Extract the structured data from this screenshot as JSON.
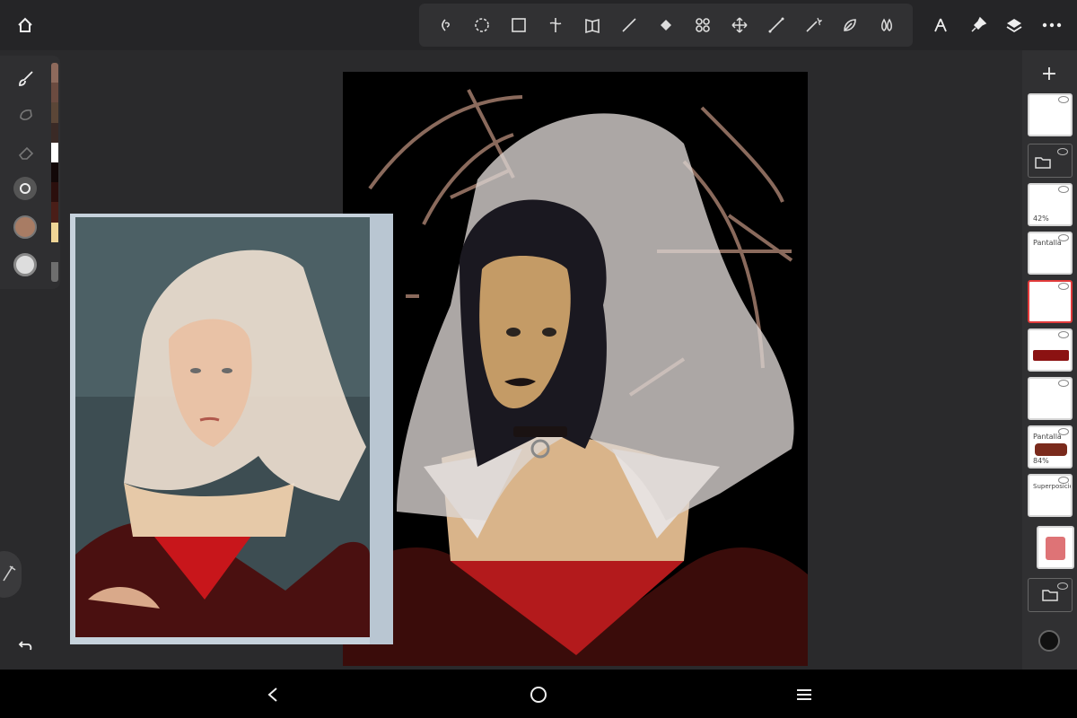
{
  "app": {
    "name": "Drawing app"
  },
  "top_toolbar": {
    "left": [
      "home-icon"
    ],
    "tools": [
      "lasso-freeform-icon",
      "lasso-dotted-icon",
      "rectangle-select-icon",
      "transform-icon",
      "mirror-icon",
      "line-icon",
      "fill-icon",
      "symmetry-icon",
      "move-icon",
      "ruler-icon",
      "magic-wand-icon",
      "smudge-icon",
      "blur-icon"
    ],
    "right": [
      "compass-icon",
      "pin-icon",
      "layers-icon",
      "more-icon"
    ]
  },
  "left_toolbar": {
    "tools": [
      "brush-icon",
      "smudge-icon",
      "eraser-icon",
      "brush-size-icon",
      "color-swatch",
      "opacity-icon"
    ],
    "brush_color": "#a87c64",
    "swatches": [
      "#8e6a5c",
      "#6b4b40",
      "#5b4637",
      "#3a2a26",
      "#ffffff",
      "#120808",
      "#2b0f0d",
      "#4a1e18",
      "#f0d596",
      "#3a3a3a",
      "#6e6e6e"
    ]
  },
  "layers_panel": {
    "layers": [
      {
        "name": "",
        "opacity": ""
      },
      {
        "name": "folder",
        "opacity": ""
      },
      {
        "name": "",
        "opacity": "42%"
      },
      {
        "name": "Pantalla",
        "opacity": ""
      },
      {
        "name": "",
        "opacity": ""
      },
      {
        "name": "",
        "opacity": ""
      },
      {
        "name": "",
        "opacity": ""
      },
      {
        "name": "Pantalla",
        "opacity": "84%"
      },
      {
        "name": "Superposición",
        "opacity": ""
      },
      {
        "name": "",
        "opacity": ""
      },
      {
        "name": "folder",
        "opacity": ""
      }
    ],
    "selected_index": 4,
    "accent": "#e23b3b"
  },
  "nav": {
    "back": "back-icon",
    "home": "home-circle-icon",
    "menu": "menu-icon"
  }
}
